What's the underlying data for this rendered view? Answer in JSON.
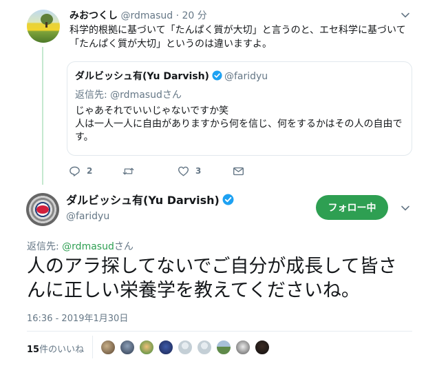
{
  "parent_tweet": {
    "display_name": "みおつくし",
    "handle": "@rdmasud",
    "separator": "·",
    "time": "20 分",
    "text_line1": "科学的根拠に基づいて「たんぱく質が大切」と言うのと、エセ科学に基づいて",
    "text_line2": "「たんぱく質が大切」というのは違いますよ。",
    "quoted": {
      "display_name": "ダルビッシュ有(Yu Darvish)",
      "handle": "@faridyu",
      "reply_to": "返信先: @rdmasudさん",
      "text_line1": "じゃあそれでいいじゃないですか笑",
      "text_line2": "人は一人一人に自由がありますから何を信じ、何をするかはその人の自由で",
      "text_line3": "す。"
    },
    "actions": {
      "reply_count": "2",
      "retweet_count": "",
      "like_count": "3"
    }
  },
  "main_tweet": {
    "display_name": "ダルビッシュ有(Yu Darvish)",
    "handle": "@faridyu",
    "follow_label": "フォロー中",
    "reply_prefix": "返信先: ",
    "reply_handle": "@rdmasud",
    "reply_suffix": "さん",
    "text_line1": "人のアラ探してないでご自分が成長して皆さ",
    "text_line2": "んに正しい栄養学を教えてくださいね。",
    "timestamp": "16:36 - 2019年1月30日",
    "likes_count": "15",
    "likes_suffix": "件のいいね"
  },
  "colors": {
    "accent": "#2e9f52",
    "verified": "#1da1f2",
    "muted": "#657786",
    "thread_line": "#c4e8cf"
  },
  "icons": {
    "reply": "reply-icon",
    "retweet": "retweet-icon",
    "like": "heart-icon",
    "dm": "envelope-icon",
    "more": "chevron-down-icon",
    "verified": "verified-badge-icon"
  }
}
